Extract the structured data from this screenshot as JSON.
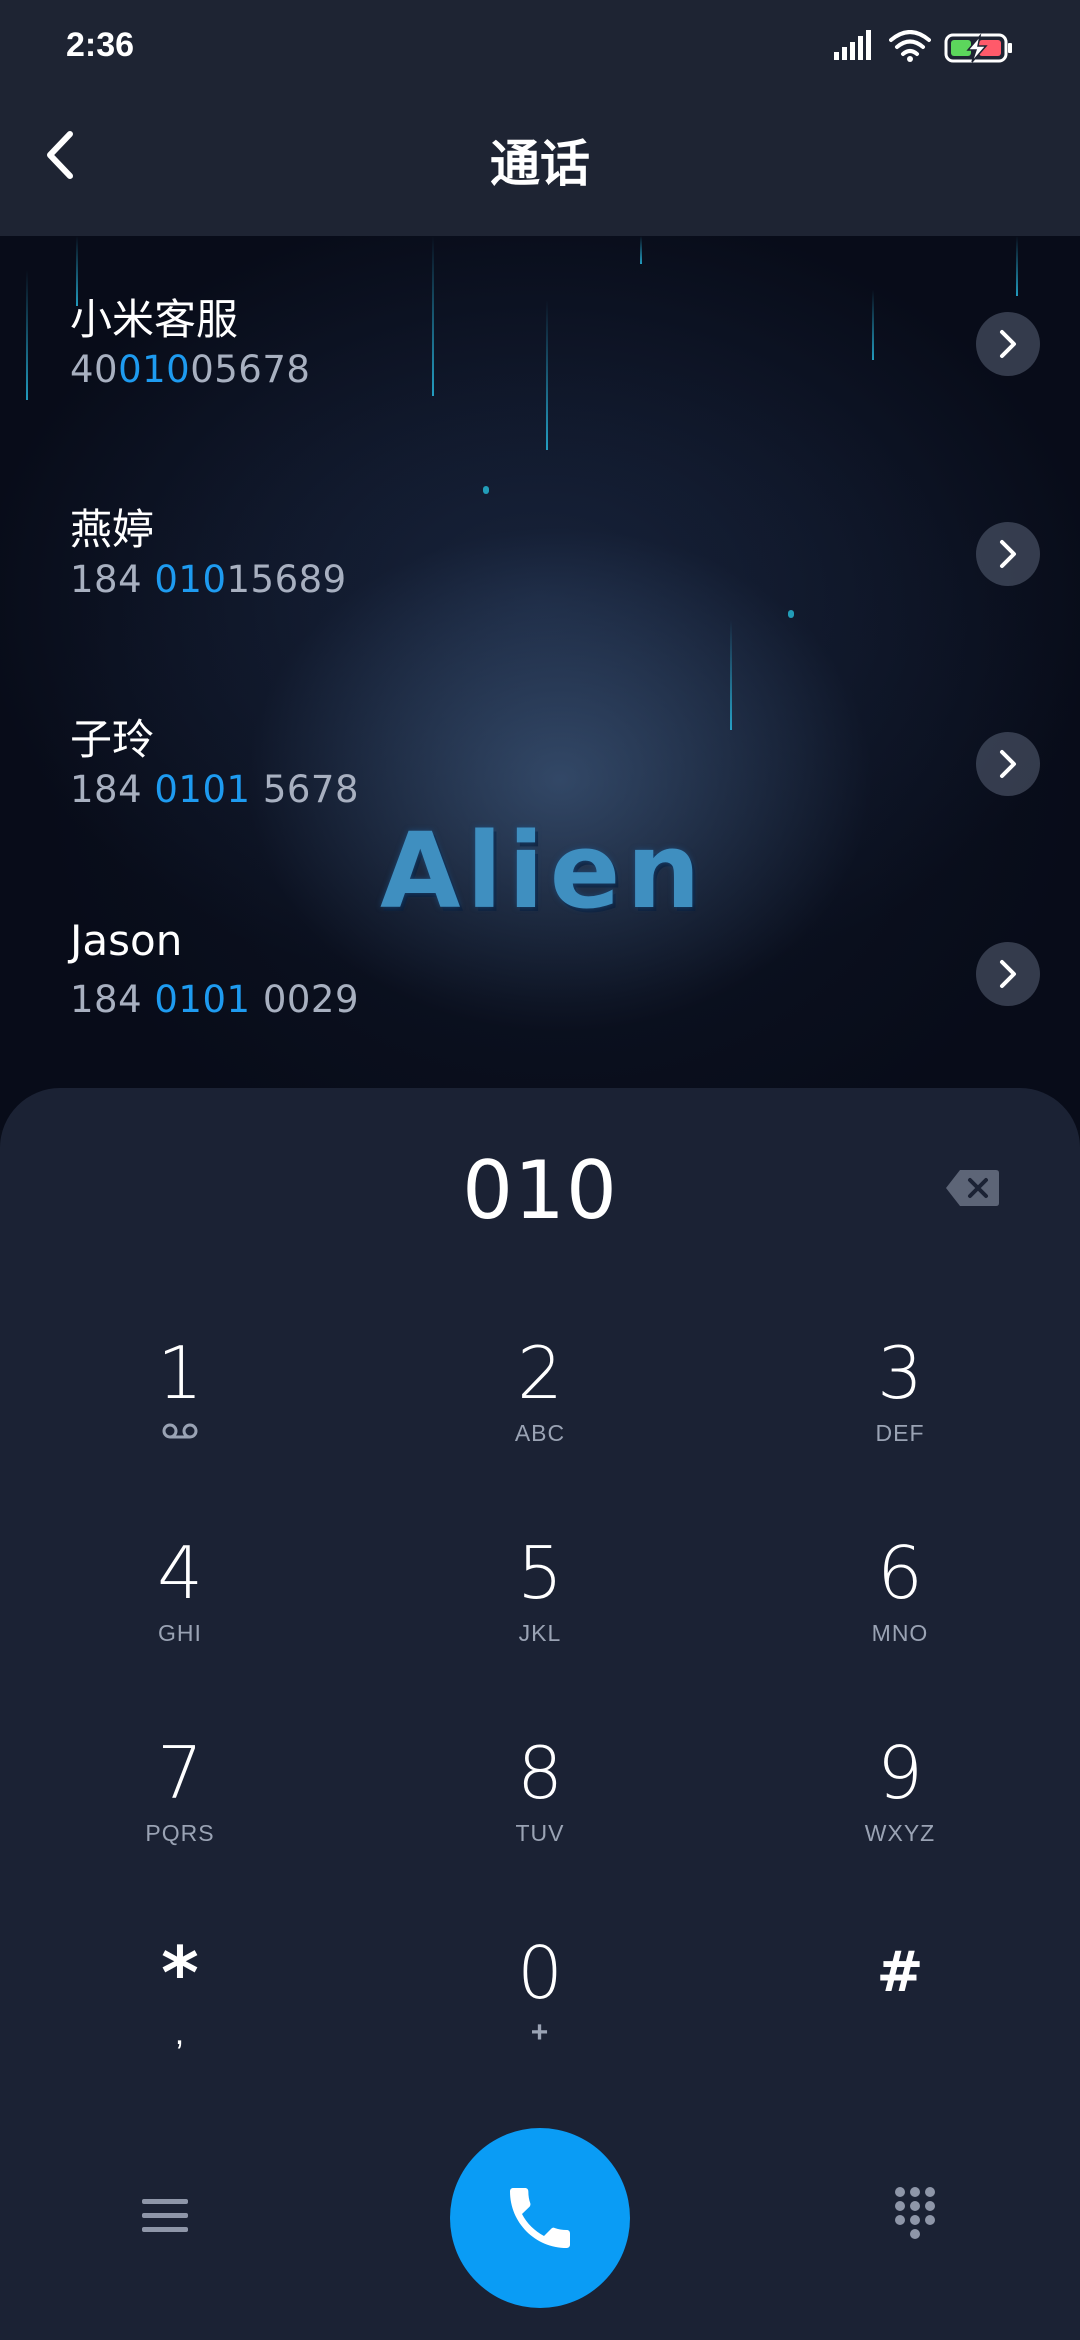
{
  "status_bar": {
    "time": "2:36",
    "icons": [
      "signal-icon",
      "wifi-icon",
      "battery-charging-icon"
    ]
  },
  "app_bar": {
    "title": "通话",
    "back_icon": "chevron-left-icon"
  },
  "wallpaper": {
    "logo_text": "Alien"
  },
  "contacts": [
    {
      "name": "小米客服",
      "number_pre": "40",
      "number_match": "010",
      "number_post": "05678"
    },
    {
      "name": "燕婷",
      "number_pre": "184 ",
      "number_match": "010",
      "number_post": "15689"
    },
    {
      "name": "子玲",
      "number_pre": "184 ",
      "number_match": "0101",
      "number_post": " 5678"
    },
    {
      "name": "Jason",
      "number_pre": "184 ",
      "number_match": "0101",
      "number_post": " 0029"
    }
  ],
  "dialpad": {
    "input": "010",
    "keys": [
      {
        "digit": "1",
        "letters": "ꝏ"
      },
      {
        "digit": "2",
        "letters": "ABC"
      },
      {
        "digit": "3",
        "letters": "DEF"
      },
      {
        "digit": "4",
        "letters": "GHI"
      },
      {
        "digit": "5",
        "letters": "JKL"
      },
      {
        "digit": "6",
        "letters": "MNO"
      },
      {
        "digit": "7",
        "letters": "PQRS"
      },
      {
        "digit": "8",
        "letters": "TUV"
      },
      {
        "digit": "9",
        "letters": "WXYZ"
      },
      {
        "digit": "*",
        "letters": ","
      },
      {
        "digit": "0",
        "letters": "+"
      },
      {
        "digit": "#",
        "letters": ""
      }
    ]
  },
  "colors": {
    "accent": "#0a9cf5",
    "match_highlight": "#1e9bf0",
    "panel": "#1b2234"
  }
}
